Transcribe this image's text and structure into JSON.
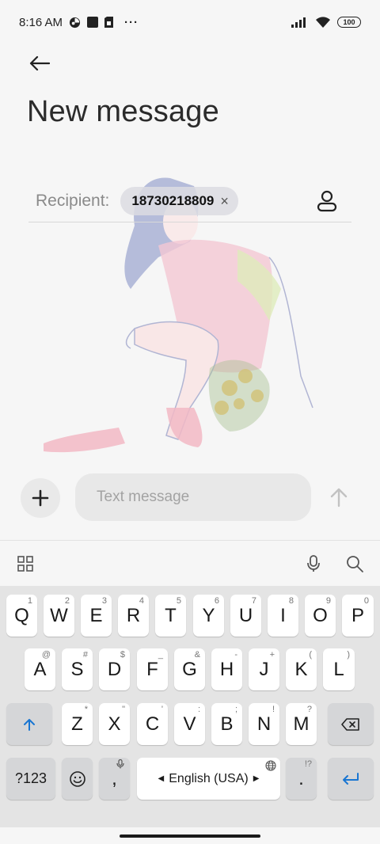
{
  "status_bar": {
    "time": "8:16 AM",
    "battery": "100",
    "more": "···",
    "icons": [
      "app-notification-icon",
      "square-notification-icon",
      "sim-card-icon",
      "signal-icon",
      "wifi-icon",
      "battery-icon"
    ]
  },
  "header": {
    "title": "New message"
  },
  "recipient": {
    "label": "Recipient:",
    "chip_number": "18730218809",
    "chip_remove": "×"
  },
  "compose": {
    "placeholder": "Text message",
    "value": ""
  },
  "keyboard": {
    "row1": [
      {
        "label": "Q",
        "sub": "1"
      },
      {
        "label": "W",
        "sub": "2"
      },
      {
        "label": "E",
        "sub": "3"
      },
      {
        "label": "R",
        "sub": "4"
      },
      {
        "label": "T",
        "sub": "5"
      },
      {
        "label": "Y",
        "sub": "6"
      },
      {
        "label": "U",
        "sub": "7"
      },
      {
        "label": "I",
        "sub": "8"
      },
      {
        "label": "O",
        "sub": "9"
      },
      {
        "label": "P",
        "sub": "0"
      }
    ],
    "row2": [
      {
        "label": "A",
        "sub": "@"
      },
      {
        "label": "S",
        "sub": "#"
      },
      {
        "label": "D",
        "sub": "$"
      },
      {
        "label": "F",
        "sub": "_"
      },
      {
        "label": "G",
        "sub": "&"
      },
      {
        "label": "H",
        "sub": "-"
      },
      {
        "label": "J",
        "sub": "+"
      },
      {
        "label": "K",
        "sub": "("
      },
      {
        "label": "L",
        "sub": ")"
      }
    ],
    "row3": [
      {
        "label": "Z",
        "sub": "*"
      },
      {
        "label": "X",
        "sub": "\""
      },
      {
        "label": "C",
        "sub": "'"
      },
      {
        "label": "V",
        "sub": ":"
      },
      {
        "label": "B",
        "sub": ";"
      },
      {
        "label": "N",
        "sub": "!"
      },
      {
        "label": "M",
        "sub": "?"
      }
    ],
    "symbols_label": "?123",
    "comma_label": ",",
    "space_label": "English (USA)",
    "period_label": ".",
    "period_sub": "!?"
  },
  "colors": {
    "accent": "#1976d2",
    "key_bg": "#ffffff",
    "keyboard_bg": "#e4e4e4"
  }
}
